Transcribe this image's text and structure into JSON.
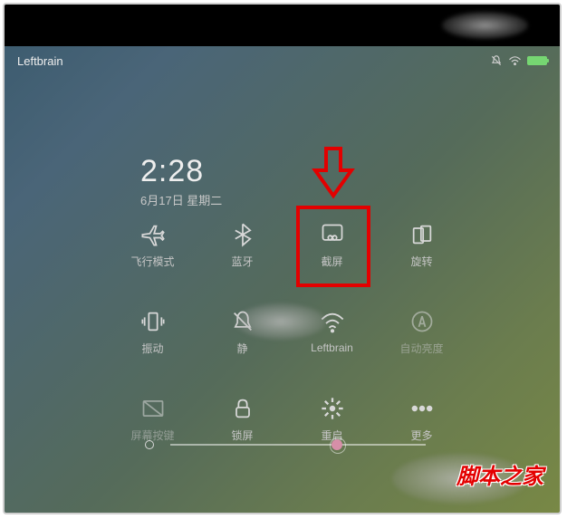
{
  "status": {
    "carrier": "Leftbrain"
  },
  "clock": {
    "time": "2:28",
    "date": "6月17日 星期二"
  },
  "tiles": [
    {
      "label": "飞行模式"
    },
    {
      "label": "蓝牙"
    },
    {
      "label": "截屏"
    },
    {
      "label": "旋转"
    },
    {
      "label": "振动"
    },
    {
      "label": "静"
    },
    {
      "label": "Leftbrain"
    },
    {
      "label": "自动亮度"
    },
    {
      "label": "屏幕按键"
    },
    {
      "label": "锁屏"
    },
    {
      "label": "重启"
    },
    {
      "label": "更多"
    }
  ],
  "watermark": "脚本之家"
}
